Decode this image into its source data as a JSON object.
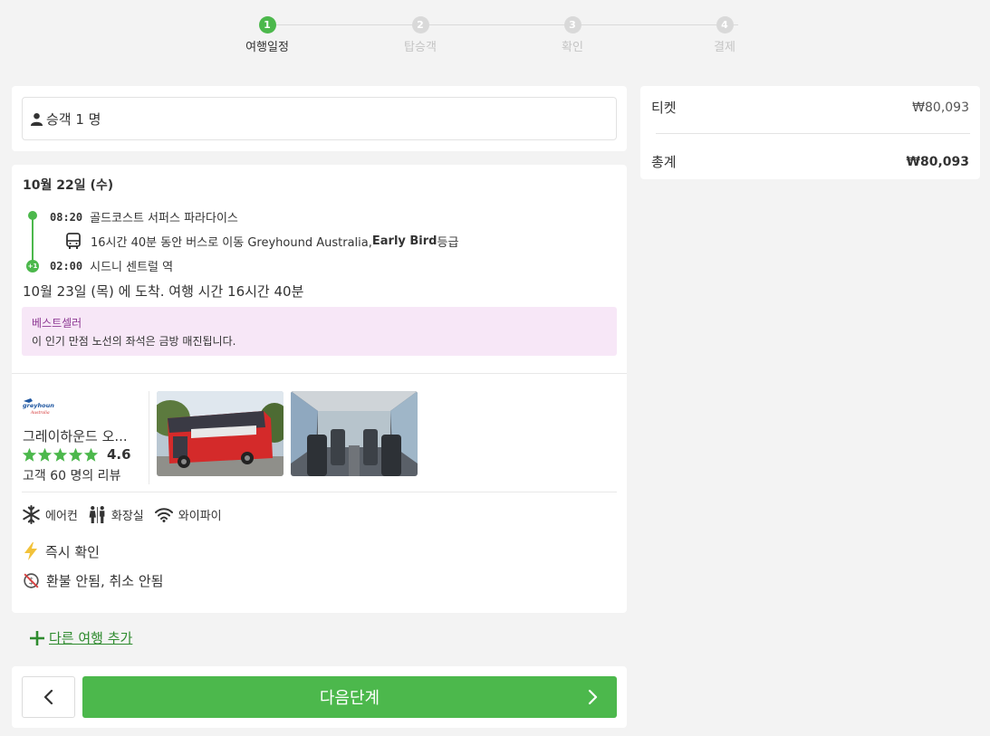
{
  "stepper": {
    "steps": [
      {
        "num": "1",
        "label": "여행일정",
        "active": true
      },
      {
        "num": "2",
        "label": "탑승객",
        "active": false
      },
      {
        "num": "3",
        "label": "확인",
        "active": false
      },
      {
        "num": "4",
        "label": "결제",
        "active": false
      }
    ]
  },
  "passengers": {
    "label": "승객 1 명",
    "icon": "person-icon"
  },
  "trip": {
    "date": "10월 22일 (수)",
    "departure": {
      "time": "08:20",
      "station": "골드코스트 서퍼스 파라다이스"
    },
    "transit": {
      "prefix": "16시간 40분 동안 버스로 이동 Greyhound Australia, ",
      "fare_class": "Early Bird",
      "suffix": " 등급",
      "icon": "bus-icon"
    },
    "arrival": {
      "time": "02:00",
      "station": "시드니 센트럴 역",
      "day_offset": "+1"
    },
    "arrival_summary": "10월 23일 (목) 에 도착. 여행 시간 16시간 40분",
    "bestseller": {
      "title": "베스트셀러",
      "text": "이 인기 만점 노선의 좌석은 금방 매진됩니다."
    },
    "operator": {
      "logo_text": "greyhound",
      "logo_sub": "Australia",
      "name": "그레이하운드 오...",
      "rating": "4.6",
      "stars": 5,
      "reviews": "고객 60 명의 리뷰"
    },
    "amenities": [
      {
        "label": "에어컨",
        "icon": "snowflake-icon"
      },
      {
        "label": "화장실",
        "icon": "restroom-icon"
      },
      {
        "label": "와이파이",
        "icon": "wifi-icon"
      }
    ],
    "instant_confirmation": "즉시 확인",
    "refund_policy": "환불 안됨, 취소 안됨"
  },
  "add_trip": {
    "label": "다른 여행 추가"
  },
  "navigation": {
    "next_label": "다음단계"
  },
  "summary": {
    "ticket_label": "티켓",
    "ticket_price": "₩80,093",
    "total_label": "총계",
    "total_price": "₩80,093"
  },
  "colors": {
    "accent": "#4cb84c",
    "bestseller_bg": "#f7e7f7",
    "bestseller_title": "#8e3a94"
  }
}
